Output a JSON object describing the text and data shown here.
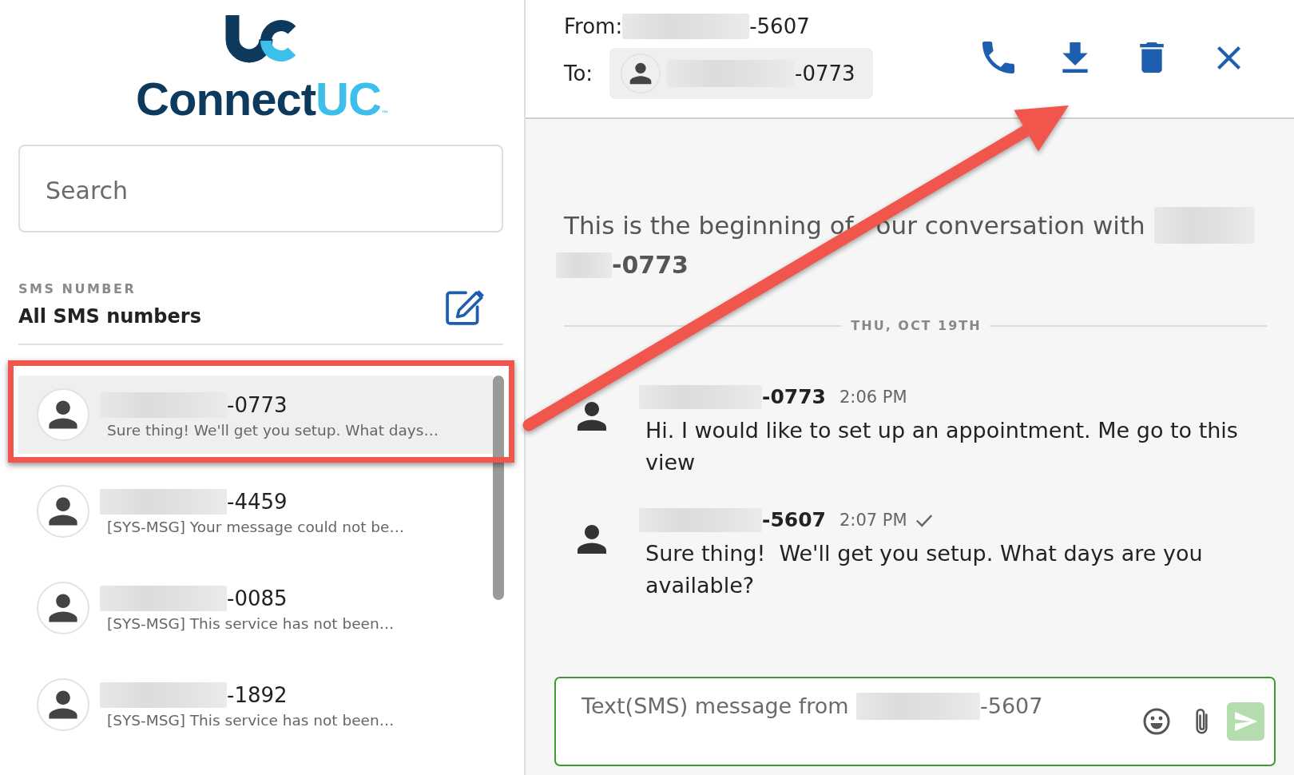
{
  "logo": {
    "text": "Connect",
    "accent": "UC",
    "tm": "™"
  },
  "search": {
    "placeholder": "Search"
  },
  "sms_filter": {
    "label": "SMS NUMBER",
    "value": "All SMS numbers"
  },
  "conversations": [
    {
      "number": "-0773",
      "preview": "Sure thing! We'll get you setup. What days…",
      "selected": true
    },
    {
      "number": "-4459",
      "preview": "[SYS-MSG] Your message could not be…",
      "selected": false
    },
    {
      "number": "-0085",
      "preview": "[SYS-MSG] This service has not been…",
      "selected": false
    },
    {
      "number": "-1892",
      "preview": "[SYS-MSG] This service has not been…",
      "selected": false
    }
  ],
  "header": {
    "from_label": "From:",
    "from_number": "-5607",
    "to_label": "To:",
    "to_number": "-0773"
  },
  "intro": {
    "text": "This is the beginning of",
    "text_after_arrow": "our conversation with",
    "number": "-0773"
  },
  "date_divider": "THU, OCT 19TH",
  "messages": [
    {
      "number": "-0773",
      "time": "2:06 PM",
      "text": "Hi. I would like to set up an appointment. Me go to this view",
      "delivered": false
    },
    {
      "number": "-5607",
      "time": "2:07 PM",
      "text": "Sure thing!  We'll get you setup. What days are you available?",
      "delivered": true
    }
  ],
  "compose": {
    "placeholder": "Text(SMS) message from",
    "placeholder_end": "-5607"
  },
  "annotations": {
    "highlight_frame": true,
    "arrow": true
  }
}
